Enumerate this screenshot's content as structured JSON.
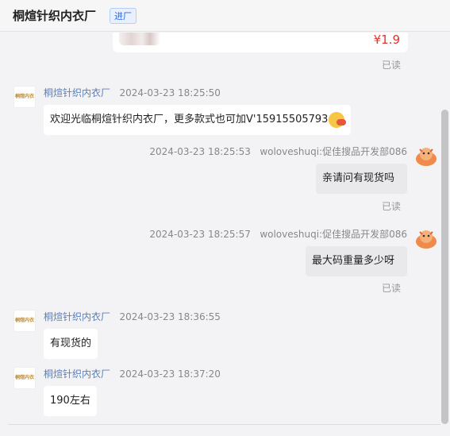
{
  "header": {
    "title": "桐煊针织内衣厂",
    "badge": "进厂"
  },
  "product": {
    "price": "¥1.9"
  },
  "shop": {
    "name": "桐煊针织内衣厂",
    "avatar_text": "桐煊内衣"
  },
  "user": {
    "name": "woloveshuqi:促佳搜品开发部086",
    "avatar_icon": "cartoon-avatar-icon"
  },
  "read_label": "已读",
  "messages": [
    {
      "time": "2024-03-23 18:25:50",
      "text": "欢迎光临桐煊针织内衣厂，更多款式也可加V'15915505793"
    },
    {
      "time": "2024-03-23 18:25:53",
      "text": "亲请问有现货吗"
    },
    {
      "time": "2024-03-23 18:25:57",
      "text": "最大码重量多少呀"
    },
    {
      "time": "2024-03-23 18:36:55",
      "text": "有现货的"
    },
    {
      "time": "2024-03-23 18:37:20",
      "text": "190左右"
    }
  ],
  "colors": {
    "accent": "#2e6ad8",
    "price": "#e5322d",
    "name": "#5a7fb8"
  }
}
